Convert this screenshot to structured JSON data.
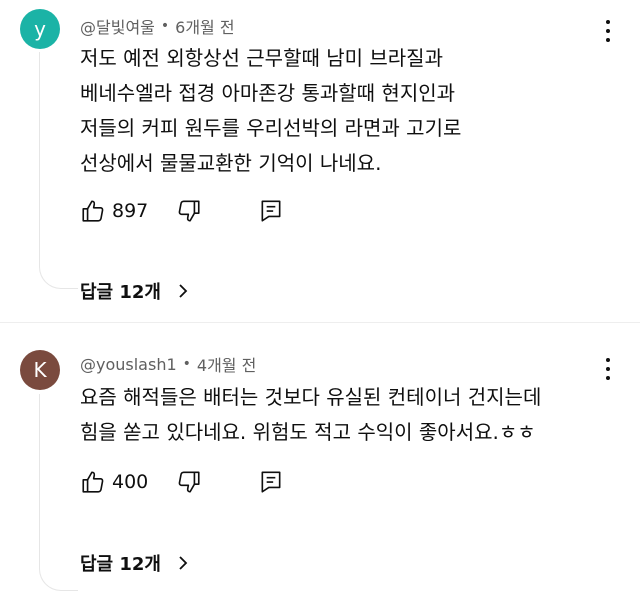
{
  "comments": [
    {
      "avatar_letter": "y",
      "avatar_color": "#1bb3a6",
      "author": "@달빛여울",
      "separator": "•",
      "time": "6개월 전",
      "lines": [
        "저도 예전 외항상선 근무할때 남미 브라질과",
        "베네수엘라 접경 아마존강 통과할때 현지인과",
        "저들의 커피 원두를 우리선박의 라면과 고기로",
        "선상에서 물물교환한 기억이 나네요."
      ],
      "likes": "897",
      "replies_label": "답글 12개"
    },
    {
      "avatar_letter": "K",
      "avatar_color": "#7a4a3e",
      "author": "@youslash1",
      "separator": "•",
      "time": "4개월 전",
      "lines": [
        "요즘 해적들은 배터는 것보다 유실된 컨테이너 건지는데",
        "힘을 쏟고 있다네요. 위험도 적고 수익이 좋아서요.ㅎㅎ"
      ],
      "likes": "400",
      "replies_label": "답글 12개"
    }
  ],
  "icons": {
    "like": "thumb-up-icon",
    "dislike": "thumb-down-icon",
    "reply": "comment-icon",
    "more": "more-vertical-icon",
    "expand": "chevron-right-icon"
  }
}
